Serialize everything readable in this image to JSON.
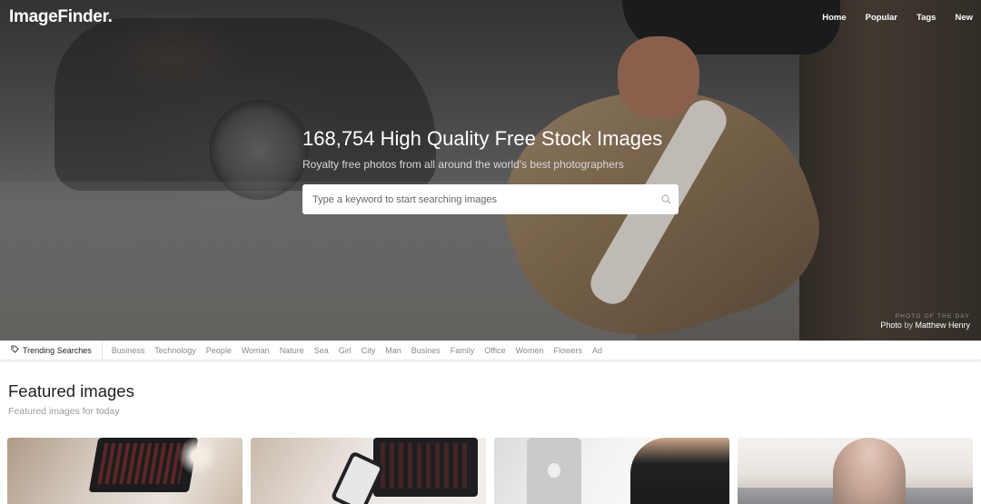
{
  "brand": {
    "logo_text": "ImageFinder."
  },
  "nav": {
    "items": [
      "Home",
      "Popular",
      "Tags",
      "New"
    ]
  },
  "hero": {
    "title": "168,754 High Quality Free Stock Images",
    "subtitle": "Royalty free photos from all around the world's best photographers",
    "search_placeholder": "Type a keyword to start searching images",
    "photo_of_the_day_label": "PHOTO OF THE DAY",
    "credit_prefix": "Photo",
    "credit_by": "by",
    "credit_author": "Matthew Henry"
  },
  "trending": {
    "label": "Trending Searches",
    "items": [
      "Business",
      "Technology",
      "People",
      "Woman",
      "Nature",
      "Sea",
      "Girl",
      "City",
      "Man",
      "Busines",
      "Family",
      "Office",
      "Women",
      "Flowers",
      "Ad"
    ]
  },
  "featured": {
    "title": "Featured images",
    "subtitle": "Featured images for today"
  },
  "icons": {
    "search": "search-icon",
    "tag": "tag-icon"
  }
}
